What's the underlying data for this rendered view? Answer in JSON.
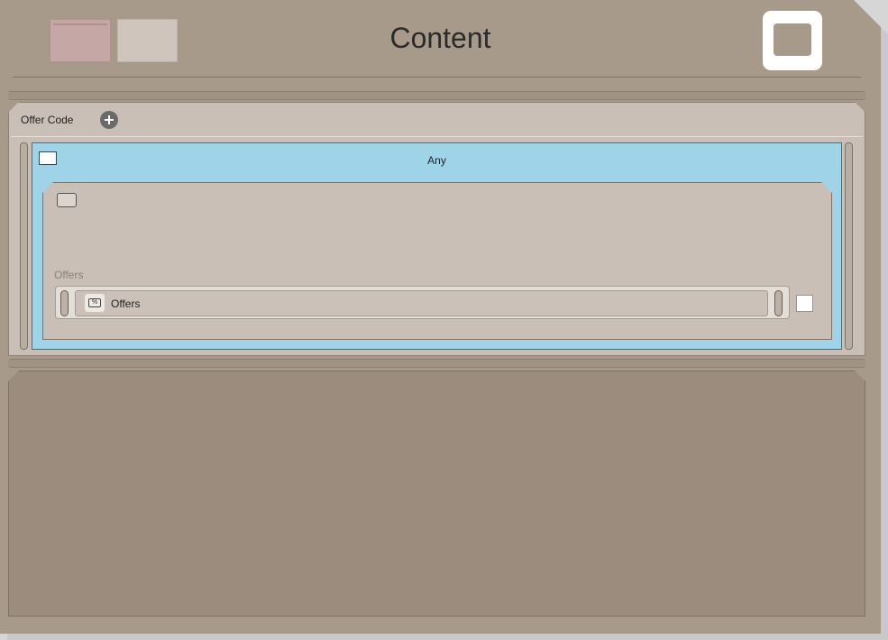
{
  "header": {
    "title": "Content"
  },
  "offer_code": {
    "label": "Offer Code"
  },
  "condition": {
    "label": "Any"
  },
  "offers": {
    "field_label": "Offers",
    "value": "Offers"
  },
  "icons": {
    "add": "plus-circle-icon",
    "offer_tag": "offer-tag-icon"
  },
  "colors": {
    "frame": "#a89a8b",
    "panel": "#c9bfb6",
    "selected": "#9fd3e8",
    "bottom": "#9c8c7e"
  }
}
